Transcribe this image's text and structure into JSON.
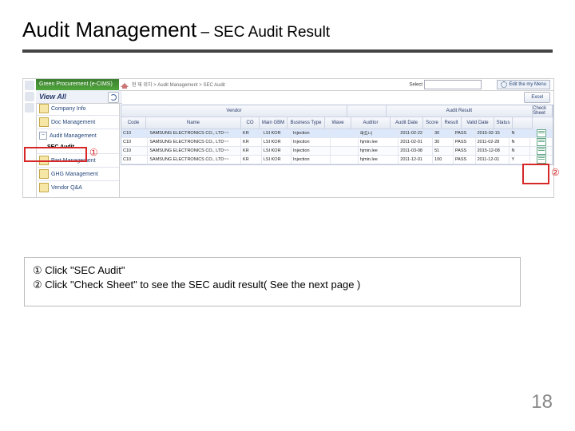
{
  "title": {
    "main": "Audit Management",
    "sep": " – ",
    "sub": "SEC Audit Result"
  },
  "pagenum": "18",
  "brand": "Green Procurement (e-CIMS)",
  "viewall": "View All",
  "breadcrumb": "현 재 위치 > Audit Management > SEC Audit",
  "select_label": "Select",
  "edit_btn": "Edit the my Menu",
  "excel_btn": "Excel",
  "sidebar": {
    "items": [
      {
        "label": "Company Info"
      },
      {
        "label": "Doc Management"
      },
      {
        "label": "Audit Management",
        "expanded": true
      },
      {
        "label": "SEC Audit",
        "sub": true
      },
      {
        "label": "Part Management"
      },
      {
        "label": "GHG Management"
      },
      {
        "label": "Vendor Q&A"
      }
    ]
  },
  "header_groups": {
    "vendor": "Vendor",
    "audit": "Audit Result",
    "check": "Check Sheet"
  },
  "columns": {
    "code": "Code",
    "name": "Name",
    "co": "CO",
    "main": "Main GBM",
    "business": "Business Type",
    "wave": "Wave",
    "auditor": "Auditor",
    "date": "Audit Date",
    "score": "Score",
    "result": "Result",
    "valid": "Valid Date",
    "status": "Status"
  },
  "rows": [
    {
      "code": "C10",
      "name": "SAMSUNG ELECTRONICS CO., LTD~~",
      "co": "KR",
      "main": "LSI KOR",
      "bt": "Injection",
      "wave": "",
      "auditor": "파트너",
      "date": "2011-02-22",
      "score": "30",
      "result": "PASS",
      "valid": "2015-02-15",
      "status": "N"
    },
    {
      "code": "C10",
      "name": "SAMSUNG ELECTRONICS CO., LTD~~",
      "co": "KR",
      "main": "LSI KOR",
      "bt": "Injection",
      "wave": "",
      "auditor": "hjmin.lee",
      "date": "2011-02-01",
      "score": "30",
      "result": "PASS",
      "valid": "2011-02-28",
      "status": "N"
    },
    {
      "code": "C10",
      "name": "SAMSUNG ELECTRONICS CO., LTD~~",
      "co": "KR",
      "main": "LSI KOR",
      "bt": "Injection",
      "wave": "",
      "auditor": "hjmin.lee",
      "date": "2011-03-08",
      "score": "51",
      "result": "PASS",
      "valid": "2015-12-08",
      "status": "N"
    },
    {
      "code": "C10",
      "name": "SAMSUNG ELECTRONICS CO., LTD~~",
      "co": "KR",
      "main": "LSI KOR",
      "bt": "Injection",
      "wave": "",
      "auditor": "hjmin.lee",
      "date": "2011-12-01",
      "score": "100",
      "result": "PASS",
      "valid": "2011-12-01",
      "status": "Y"
    }
  ],
  "callouts": {
    "one": "①",
    "two": "②"
  },
  "instructions": {
    "line1": "① Click \"SEC Audit\"",
    "line2": "② Click \"Check Sheet\" to see the SEC audit result( See the next page )"
  }
}
